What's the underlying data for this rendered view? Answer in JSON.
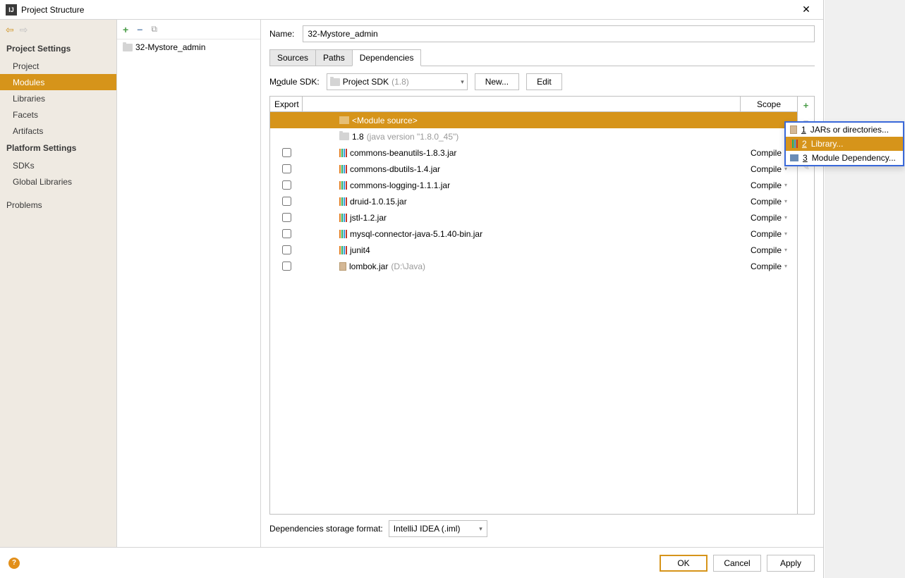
{
  "titlebar": {
    "title": "Project Structure"
  },
  "sidebar": {
    "section1": "Project Settings",
    "items1": [
      {
        "label": "Project"
      },
      {
        "label": "Modules",
        "selected": true
      },
      {
        "label": "Libraries"
      },
      {
        "label": "Facets"
      },
      {
        "label": "Artifacts"
      }
    ],
    "section2": "Platform Settings",
    "items2": [
      {
        "label": "SDKs"
      },
      {
        "label": "Global Libraries"
      }
    ],
    "section3": "Problems"
  },
  "modules": {
    "items": [
      {
        "name": "32-Mystore_admin"
      }
    ]
  },
  "main": {
    "name_label": "Name:",
    "name_value": "32-Mystore_admin",
    "tabs": [
      {
        "label": "Sources"
      },
      {
        "label": "Paths"
      },
      {
        "label": "Dependencies",
        "active": true
      }
    ],
    "sdk_label_pre": "M",
    "sdk_label_u": "o",
    "sdk_label_post": "dule SDK:",
    "sdk_value": "Project SDK",
    "sdk_version": "(1.8)",
    "new_btn": "New...",
    "edit_btn": "Edit",
    "header_export": "Export",
    "header_scope": "Scope",
    "rows": [
      {
        "type": "module_src",
        "label": "<Module source>",
        "selected": true
      },
      {
        "type": "jdk",
        "label": "1.8 ",
        "grey": "(java version \"1.8.0_45\")"
      },
      {
        "type": "lib",
        "checkable": true,
        "label": "commons-beanutils-1.8.3.jar",
        "scope": "Compile"
      },
      {
        "type": "lib",
        "checkable": true,
        "label": "commons-dbutils-1.4.jar",
        "scope": "Compile"
      },
      {
        "type": "lib",
        "checkable": true,
        "label": "commons-logging-1.1.1.jar",
        "scope": "Compile"
      },
      {
        "type": "lib",
        "checkable": true,
        "label": "druid-1.0.15.jar",
        "scope": "Compile"
      },
      {
        "type": "lib",
        "checkable": true,
        "label": "jstl-1.2.jar",
        "scope": "Compile"
      },
      {
        "type": "lib",
        "checkable": true,
        "label": "mysql-connector-java-5.1.40-bin.jar",
        "scope": "Compile"
      },
      {
        "type": "lib",
        "checkable": true,
        "label": "junit4",
        "scope": "Compile"
      },
      {
        "type": "jar",
        "checkable": true,
        "label": "lombok.jar ",
        "grey": "(D:\\Java)",
        "scope": "Compile"
      }
    ],
    "storage_label": "Dependencies storage format:",
    "storage_value": "IntelliJ IDEA (.iml)"
  },
  "popup": {
    "items": [
      {
        "num": "1",
        "label": "JARs or directories..."
      },
      {
        "num": "2",
        "label": "Library...",
        "selected": true
      },
      {
        "num": "3",
        "label": "Module Dependency..."
      }
    ]
  },
  "footer": {
    "ok": "OK",
    "cancel": "Cancel",
    "apply": "Apply"
  }
}
